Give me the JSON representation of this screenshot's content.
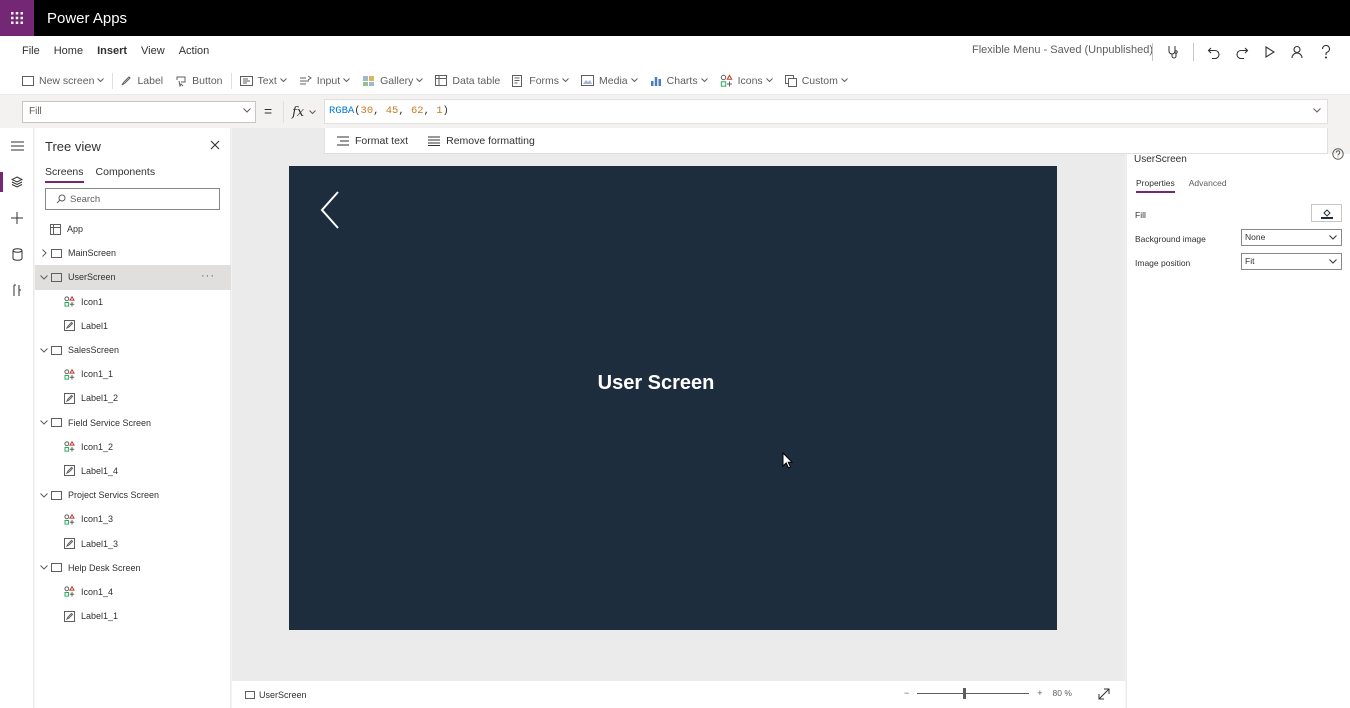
{
  "app": {
    "name": "Power Apps",
    "brand_color": "#742774"
  },
  "menu": {
    "items": [
      "File",
      "Home",
      "Insert",
      "View",
      "Action"
    ],
    "active": "Insert",
    "status": "Flexible Menu - Saved (Unpublished)"
  },
  "ribbon": {
    "new_screen": "New screen",
    "label": "Label",
    "button": "Button",
    "text": "Text",
    "input": "Input",
    "gallery": "Gallery",
    "data_table": "Data table",
    "forms": "Forms",
    "media": "Media",
    "charts": "Charts",
    "icons": "Icons",
    "custom": "Custom"
  },
  "formula": {
    "property": "Fill",
    "equals": "=",
    "fx": "fx",
    "function_name": "RGBA",
    "open_paren": "(",
    "r": "30",
    "g": "45",
    "b": "62",
    "a": "1",
    "close_paren": ")",
    "format_text": "Format text",
    "remove_formatting": "Remove formatting"
  },
  "tree": {
    "title": "Tree view",
    "tabs": [
      "Screens",
      "Components"
    ],
    "search_placeholder": "Search",
    "app": "App",
    "nodes": [
      {
        "label": "MainScreen"
      },
      {
        "label": "UserScreen"
      },
      {
        "label": "Icon1"
      },
      {
        "label": "Label1"
      },
      {
        "label": "SalesScreen"
      },
      {
        "label": "Icon1_1"
      },
      {
        "label": "Label1_2"
      },
      {
        "label": "Field Service Screen"
      },
      {
        "label": "Icon1_2"
      },
      {
        "label": "Label1_4"
      },
      {
        "label": "Project Servics Screen"
      },
      {
        "label": "Icon1_3"
      },
      {
        "label": "Label1_3"
      },
      {
        "label": "Help Desk Screen"
      },
      {
        "label": "Icon1_4"
      },
      {
        "label": "Label1_1"
      }
    ]
  },
  "canvas": {
    "screen_label": "User Screen",
    "screen_color": "#1e2d3e",
    "canvas_bg": "#ebebeb"
  },
  "footer": {
    "screen": "UserScreen",
    "zoom_minus": "−",
    "zoom_plus": "+",
    "zoom": "80 %"
  },
  "properties": {
    "selected": "UserScreen",
    "tabs": [
      "Properties",
      "Advanced"
    ],
    "fill_label": "Fill",
    "background_image_label": "Background image",
    "background_image_value": "None",
    "image_position_label": "Image position",
    "image_position_value": "Fit"
  }
}
